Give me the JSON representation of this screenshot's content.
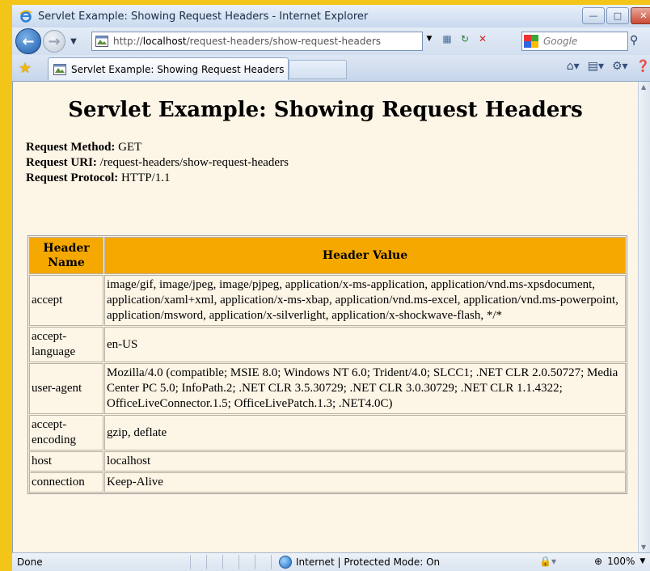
{
  "window": {
    "title": "Servlet Example: Showing Request Headers - Internet Explorer"
  },
  "address": {
    "url_prefix": "http://",
    "url_host": "localhost",
    "url_path": "/request-headers/show-request-headers",
    "search_placeholder": "Google"
  },
  "tab": {
    "label": "Servlet Example: Showing Request Headers"
  },
  "page": {
    "heading": "Servlet Example: Showing Request Headers",
    "method_label": "Request Method:",
    "method_value": "GET",
    "uri_label": "Request URI:",
    "uri_value": "/request-headers/show-request-headers",
    "protocol_label": "Request Protocol:",
    "protocol_value": "HTTP/1.1",
    "table": {
      "col_name": "Header Name",
      "col_value": "Header Value",
      "rows": [
        {
          "name": "accept",
          "value": "image/gif, image/jpeg, image/pjpeg, application/x-ms-application, application/vnd.ms-xpsdocument, application/xaml+xml, application/x-ms-xbap, application/vnd.ms-excel, application/vnd.ms-powerpoint, application/msword, application/x-silverlight, application/x-shockwave-flash, */*"
        },
        {
          "name": "accept-language",
          "value": "en-US"
        },
        {
          "name": "user-agent",
          "value": "Mozilla/4.0 (compatible; MSIE 8.0; Windows NT 6.0; Trident/4.0; SLCC1; .NET CLR 2.0.50727; Media Center PC 5.0; InfoPath.2; .NET CLR 3.5.30729; .NET CLR 3.0.30729; .NET CLR 1.1.4322; OfficeLiveConnector.1.5; OfficeLivePatch.1.3; .NET4.0C)"
        },
        {
          "name": "accept-encoding",
          "value": "gzip, deflate"
        },
        {
          "name": "host",
          "value": "localhost"
        },
        {
          "name": "connection",
          "value": "Keep-Alive"
        }
      ]
    }
  },
  "status": {
    "left": "Done",
    "zone": "Internet | Protected Mode: On",
    "zoom": "100%"
  },
  "colors": {
    "table_header": "#f5a800",
    "page_background": "#fdf5e6"
  }
}
